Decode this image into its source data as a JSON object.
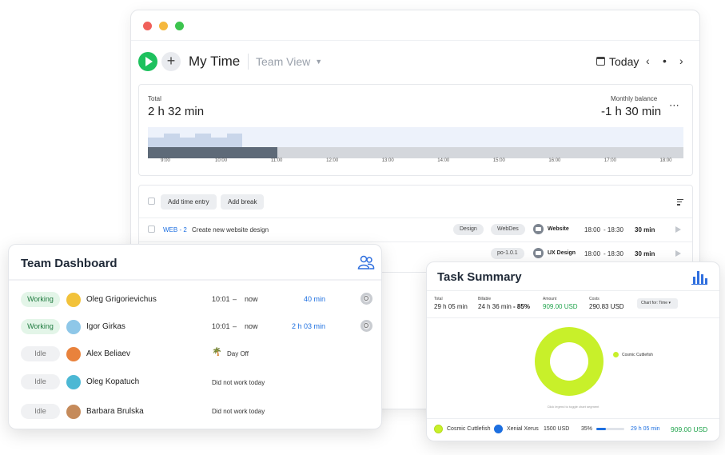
{
  "window": {
    "title": "My Time",
    "view_switch": "Team View",
    "date_label": "Today",
    "nav_prev": "‹",
    "nav_dot": "•",
    "nav_next": "›"
  },
  "summary": {
    "total_label": "Total",
    "total_value": "2 h 32 min",
    "balance_label": "Monthly balance",
    "balance_value": "-1 h 30 min",
    "timeline_ticks": [
      "9:00",
      "10:00",
      "11:00",
      "12:00",
      "13:00",
      "14:00",
      "15:00",
      "16:00",
      "17:00",
      "18:00"
    ]
  },
  "entries": {
    "add_time_label": "Add time entry",
    "add_break_label": "Add break",
    "rows": [
      {
        "ticket": "WEB - 2",
        "description": "Create new website design",
        "tags": [
          "Design",
          "WebDes"
        ],
        "project": "Website",
        "start": "18:00",
        "end": "- 18:30",
        "duration": "30 min"
      },
      {
        "ticket": "",
        "description": "",
        "tags": [
          "po-1.0.1"
        ],
        "project": "UX Design",
        "start": "18:00",
        "end": "- 18:30",
        "duration": "30 min"
      }
    ]
  },
  "team": {
    "title": "Team Dashboard",
    "members": [
      {
        "status": "Working",
        "name": "Oleg Grigorievichus",
        "time_from": "10:01",
        "dash": "–",
        "time_to": "now",
        "duration": "40 min",
        "note": ""
      },
      {
        "status": "Working",
        "name": "Igor Girkas",
        "time_from": "10:01",
        "dash": "–",
        "time_to": "now",
        "duration": "2 h 03 min",
        "note": ""
      },
      {
        "status": "Idle",
        "name": "Alex Beliaev",
        "time_from": "",
        "dash": "",
        "time_to": "",
        "duration": "",
        "note": "Day Off"
      },
      {
        "status": "Idle",
        "name": "Oleg Kopatuch",
        "time_from": "",
        "dash": "",
        "time_to": "",
        "duration": "",
        "note": "Did not work today"
      },
      {
        "status": "Idle",
        "name": "Barbara Brulska",
        "time_from": "",
        "dash": "",
        "time_to": "",
        "duration": "",
        "note": "Did not work today"
      }
    ]
  },
  "task_summary": {
    "title": "Task Summary",
    "stats": [
      {
        "label": "Total",
        "value": "29 h 05 min"
      },
      {
        "label": "Billable",
        "value": "24 h 36 min",
        "percent": "- 85%"
      },
      {
        "label": "Amount",
        "value": "909.00 USD"
      },
      {
        "label": "Costs",
        "value": "290.83 USD"
      }
    ],
    "chart_for": "Chart for: Time",
    "legend": "Cosmic Cuttlefish",
    "hint": "Click legend to toggle chart segment",
    "footer": {
      "project": "Cosmic Cuttlefish",
      "client": "Xenial Xerus",
      "budget": "1500 USD",
      "percent": "35%",
      "progress": 0.35,
      "time": "29 h 05 min",
      "amount": "909.00 USD"
    },
    "chart_data": {
      "type": "pie",
      "categories": [
        "Cosmic Cuttlefish"
      ],
      "values": [
        100
      ],
      "title": "",
      "legend_position": "right"
    }
  },
  "colors": {
    "accent_green": "#1ec15e",
    "link_blue": "#1d6fe0",
    "donut_lime": "#c8f02a"
  }
}
